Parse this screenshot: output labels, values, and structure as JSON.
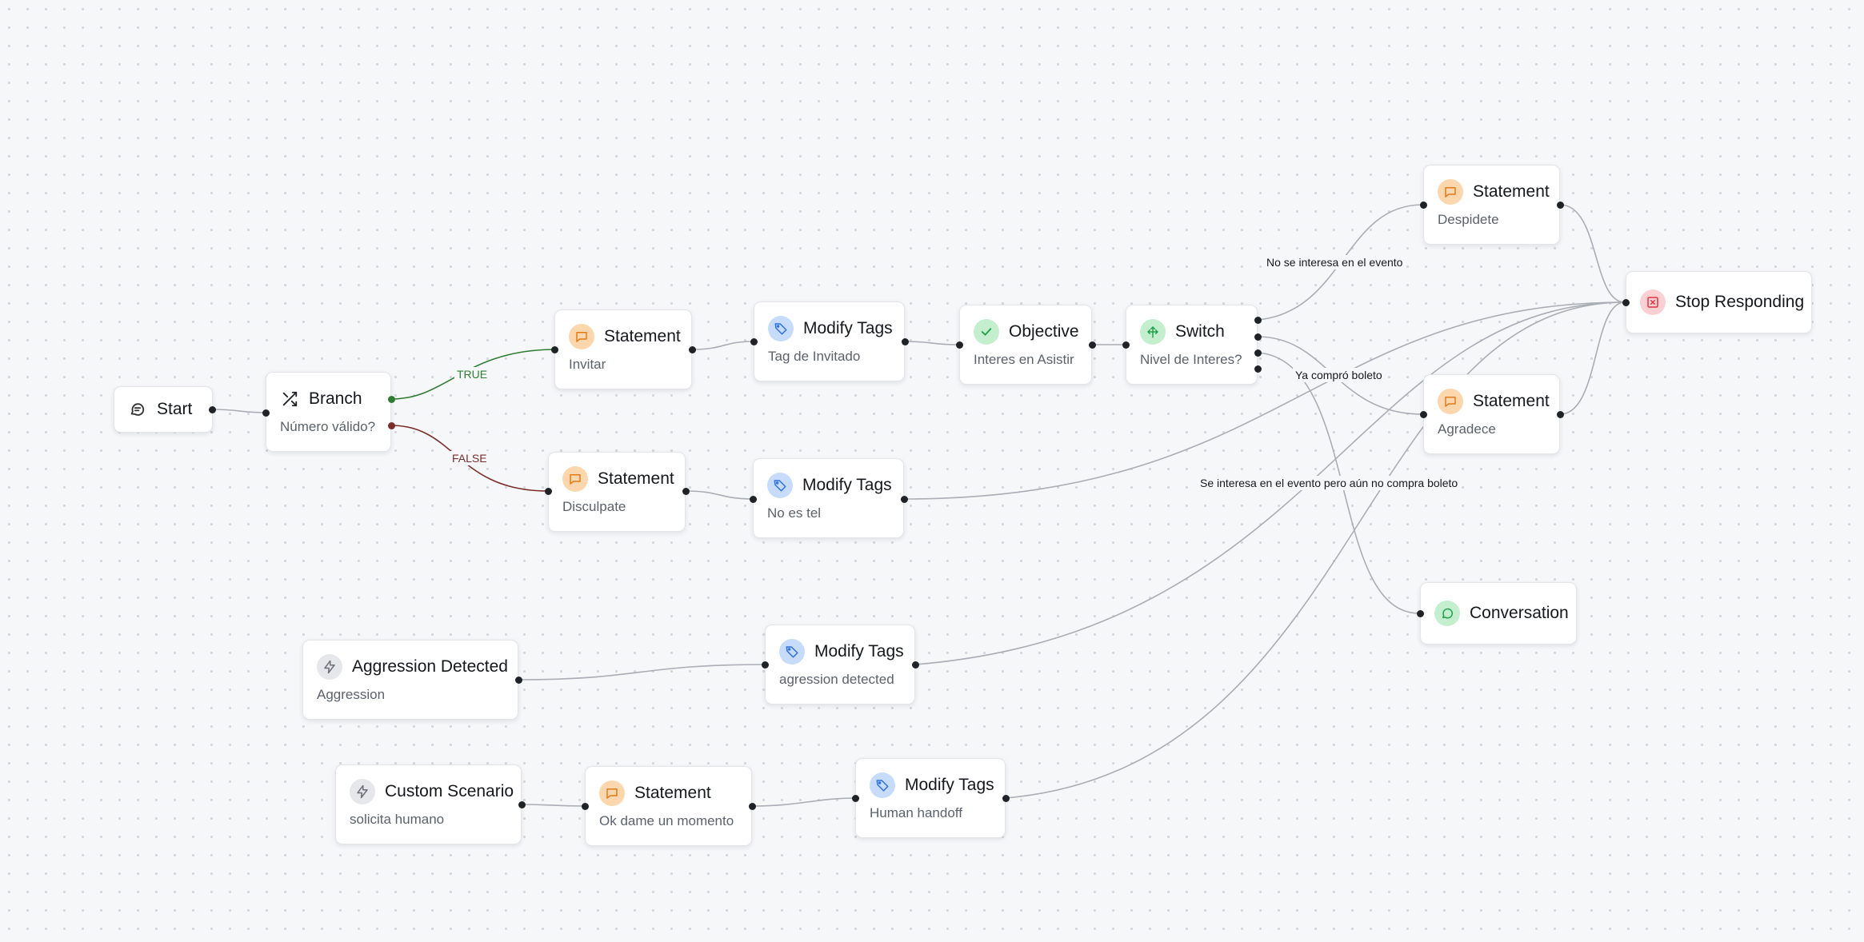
{
  "nodes": {
    "start": {
      "title": "Start",
      "icon": "chat-bubble-icon"
    },
    "branch": {
      "title": "Branch",
      "subtitle": "Número válido?",
      "icon": "shuffle-icon"
    },
    "stmt_invitar": {
      "title": "Statement",
      "subtitle": "Invitar",
      "icon": "message-square-icon"
    },
    "tags_invitado": {
      "title": "Modify Tags",
      "subtitle": "Tag de Invitado",
      "icon": "tag-icon"
    },
    "objective": {
      "title": "Objective",
      "subtitle": "Interes en Asistir",
      "icon": "check-icon"
    },
    "switch": {
      "title": "Switch",
      "subtitle": "Nivel de Interes?",
      "icon": "split-arrows-icon"
    },
    "stmt_despidete": {
      "title": "Statement",
      "subtitle": "Despidete",
      "icon": "message-square-icon"
    },
    "stop": {
      "title": "Stop Responding",
      "icon": "x-square-icon"
    },
    "stmt_agradece": {
      "title": "Statement",
      "subtitle": "Agradece",
      "icon": "message-square-icon"
    },
    "stmt_disculpate": {
      "title": "Statement",
      "subtitle": "Disculpate",
      "icon": "message-square-icon"
    },
    "tags_noestel": {
      "title": "Modify Tags",
      "subtitle": "No es tel",
      "icon": "tag-icon"
    },
    "conversation": {
      "title": "Conversation",
      "icon": "conversation-bubble-icon"
    },
    "aggression": {
      "title": "Aggression Detected",
      "subtitle": "Aggression",
      "icon": "lightning-icon"
    },
    "tags_aggression": {
      "title": "Modify Tags",
      "subtitle": "agression detected",
      "icon": "tag-icon"
    },
    "custom": {
      "title": "Custom Scenario",
      "subtitle": "solicita humano",
      "icon": "lightning-icon"
    },
    "stmt_momento": {
      "title": "Statement",
      "subtitle": "Ok dame un momento",
      "icon": "message-square-icon"
    },
    "tags_human": {
      "title": "Modify Tags",
      "subtitle": "Human handoff",
      "icon": "tag-icon"
    }
  },
  "edge_labels": {
    "true": "TRUE",
    "false": "FALSE",
    "no_interesa": "No se interesa en el evento",
    "ya_compro": "Ya compró boleto",
    "interesa_no_compra": "Se interesa en el evento pero aún no compra boleto"
  },
  "colors": {
    "true_edge": "#2e7d32",
    "false_edge": "#7b2d2d",
    "edge": "#a9adb4",
    "handle": "#1f2328"
  }
}
